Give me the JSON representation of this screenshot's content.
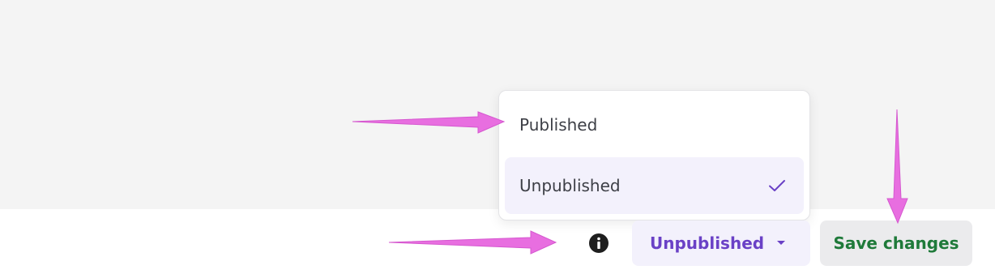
{
  "status_menu": {
    "options": [
      {
        "label": "Published",
        "selected": false
      },
      {
        "label": "Unpublished",
        "selected": true
      }
    ]
  },
  "footer": {
    "info_icon": "info-icon",
    "status_button_label": "Unpublished",
    "save_button_label": "Save changes"
  },
  "colors": {
    "accent_purple": "#6a41c6",
    "save_green": "#1f7a3a",
    "selected_bg": "#f3f1fc",
    "annotation_arrow": "#e86ee0"
  }
}
